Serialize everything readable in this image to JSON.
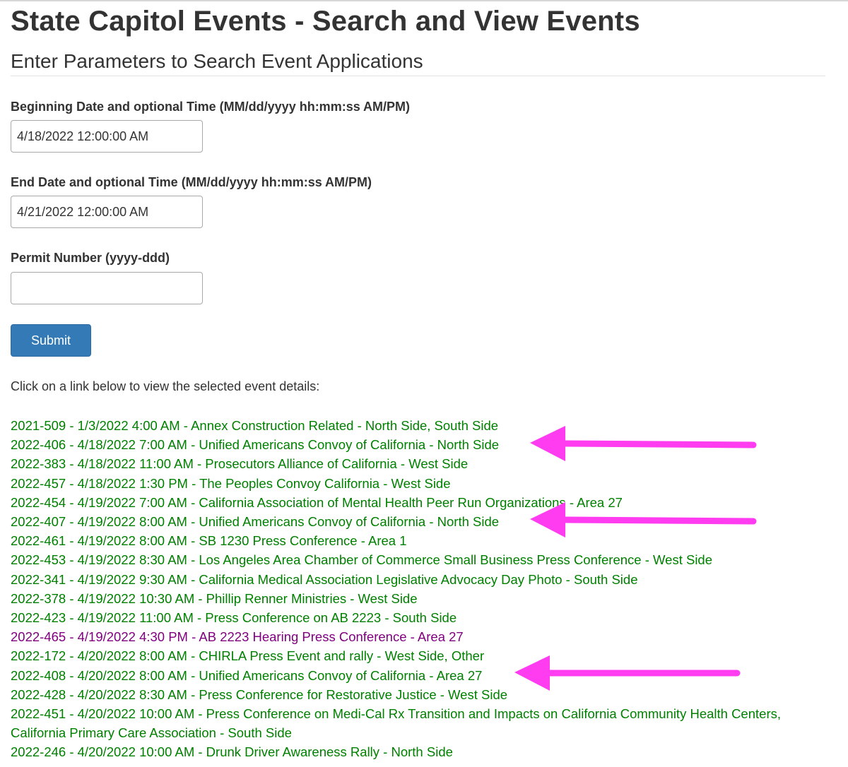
{
  "header": {
    "title": "State Capitol Events - Search and View Events",
    "subtitle": "Enter Parameters to Search Event Applications"
  },
  "form": {
    "begin_label": "Beginning Date and optional Time (MM/dd/yyyy hh:mm:ss AM/PM)",
    "begin_value": "4/18/2022 12:00:00 AM",
    "end_label": "End Date and optional Time (MM/dd/yyyy hh:mm:ss AM/PM)",
    "end_value": "4/21/2022 12:00:00 AM",
    "permit_label": "Permit Number (yyyy-ddd)",
    "permit_value": "",
    "submit_label": "Submit"
  },
  "results": {
    "instructions": "Click on a link below to view the selected event details:",
    "events": [
      {
        "text": "2021-509 - 1/3/2022 4:00 AM - Annex Construction Related - North Side, South Side",
        "visited": false
      },
      {
        "text": "2022-406 - 4/18/2022 7:00 AM - Unified Americans Convoy of California - North Side",
        "visited": false
      },
      {
        "text": "2022-383 - 4/18/2022 11:00 AM - Prosecutors Alliance of California - West Side",
        "visited": false
      },
      {
        "text": "2022-457 - 4/18/2022 1:30 PM - The Peoples Convoy California - West Side",
        "visited": false
      },
      {
        "text": "2022-454 - 4/19/2022 7:00 AM - California Association of Mental Health Peer Run Organizations - Area 27",
        "visited": false
      },
      {
        "text": "2022-407 - 4/19/2022 8:00 AM - Unified Americans Convoy of California - North Side",
        "visited": false
      },
      {
        "text": "2022-461 - 4/19/2022 8:00 AM - SB 1230 Press Conference - Area 1",
        "visited": false
      },
      {
        "text": "2022-453 - 4/19/2022 8:30 AM - Los Angeles Area Chamber of Commerce Small Business Press Conference - West Side",
        "visited": false
      },
      {
        "text": "2022-341 - 4/19/2022 9:30 AM - California Medical Association Legislative Advocacy Day Photo - South Side",
        "visited": false
      },
      {
        "text": "2022-378 - 4/19/2022 10:30 AM - Phillip Renner Ministries - West Side",
        "visited": false
      },
      {
        "text": "2022-423 - 4/19/2022 11:00 AM - Press Conference on AB 2223 - South Side",
        "visited": false
      },
      {
        "text": "2022-465 - 4/19/2022 4:30 PM - AB 2223 Hearing Press Conference - Area 27",
        "visited": true
      },
      {
        "text": "2022-172 - 4/20/2022 8:00 AM - CHIRLA Press Event and rally - West Side, Other",
        "visited": false
      },
      {
        "text": "2022-408 - 4/20/2022 8:00 AM - Unified Americans Convoy of California - Area 27",
        "visited": false
      },
      {
        "text": "2022-428 - 4/20/2022 8:30 AM - Press Conference for Restorative Justice - West Side",
        "visited": false
      },
      {
        "text": "2022-451 - 4/20/2022 10:00 AM - Press Conference on Medi-Cal Rx Transition and Impacts on California Community Health Centers, California Primary Care Association - South Side",
        "visited": false
      },
      {
        "text": "2022-246 - 4/20/2022 10:00 AM - Drunk Driver Awareness Rally - North Side",
        "visited": false
      }
    ]
  },
  "colors": {
    "link": "#008000",
    "visited_link": "#800080",
    "button": "#337ab7",
    "annotation_arrow": "#ff3cf0"
  }
}
